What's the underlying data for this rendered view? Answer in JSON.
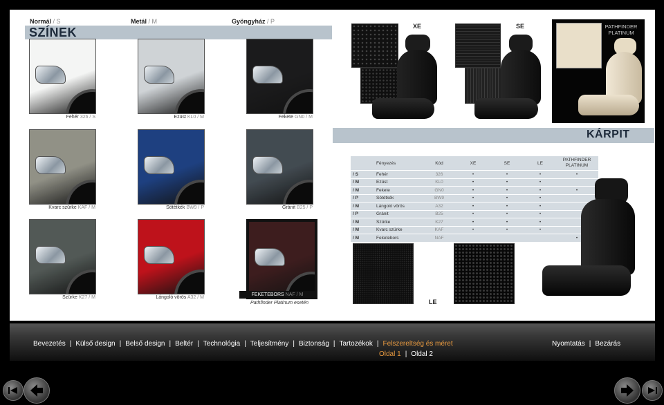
{
  "legend": {
    "normal": {
      "name": "Normál",
      "code": "S"
    },
    "metal": {
      "name": "Metál",
      "code": "M"
    },
    "pearl": {
      "name": "Gyöngyház",
      "code": "P"
    }
  },
  "colors_title": "SZÍNEK",
  "upholstery_title": "KÁRPIT",
  "cars": [
    {
      "name": "Fehér",
      "code": "326 / S",
      "color": "#e8e9e8"
    },
    {
      "name": "Ezüst",
      "code": "KL0 / M",
      "color": "#c5c9cc"
    },
    {
      "name": "Fekete",
      "code": "GN0 / M",
      "color": "#1a1a1b"
    },
    {
      "name": "Kvarc szürke",
      "code": "KAF / M",
      "color": "#8a8a80"
    },
    {
      "name": "Sötétkék",
      "code": "BW9 / P",
      "color": "#1d3d7a"
    },
    {
      "name": "Gránit",
      "code": "B25 / P",
      "color": "#3f474d"
    },
    {
      "name": "Szürke",
      "code": "K27 / M",
      "color": "#4e5552"
    },
    {
      "name": "Lángoló vörös",
      "code": "A32 / M",
      "color": "#b5111a"
    },
    {
      "name": "FEKETEBORS",
      "code": "NAF / M",
      "color": "#3a1c1d",
      "note": "Pathfinder Platinum esetén"
    }
  ],
  "trims": {
    "xe": "XE",
    "se": "SE",
    "platinum": "PATHFINDER PLATINUM",
    "le": "LE"
  },
  "table": {
    "headers": [
      "Fényezés",
      "Kód",
      "XE",
      "SE",
      "LE",
      "PATHFINDER PLATINUM"
    ],
    "rows": [
      {
        "type": "/ S",
        "name": "Fehér",
        "code": "326",
        "xe": "•",
        "se": "•",
        "le": "•",
        "pp": "•"
      },
      {
        "type": "/ M",
        "name": "Ezüst",
        "code": "KL0",
        "xe": "•",
        "se": "•",
        "le": "•",
        "pp": ""
      },
      {
        "type": "/ M",
        "name": "Fekete",
        "code": "GN0",
        "xe": "•",
        "se": "•",
        "le": "•",
        "pp": "•"
      },
      {
        "type": "/ P",
        "name": "Sötétkék",
        "code": "BW9",
        "xe": "•",
        "se": "•",
        "le": "•",
        "pp": ""
      },
      {
        "type": "/ M",
        "name": "Lángoló vörös",
        "code": "A32",
        "xe": "•",
        "se": "•",
        "le": "•",
        "pp": ""
      },
      {
        "type": "/ P",
        "name": "Gránit",
        "code": "B25",
        "xe": "•",
        "se": "•",
        "le": "•",
        "pp": ""
      },
      {
        "type": "/ M",
        "name": "Szürke",
        "code": "K27",
        "xe": "•",
        "se": "•",
        "le": "•",
        "pp": ""
      },
      {
        "type": "/ M",
        "name": "Kvarc szürke",
        "code": "KAF",
        "xe": "•",
        "se": "•",
        "le": "•",
        "pp": ""
      },
      {
        "type": "/ M",
        "name": "Feketebors",
        "code": "NAF",
        "xe": "",
        "se": "",
        "le": "",
        "pp": "•"
      }
    ]
  },
  "nav": {
    "items": [
      "Bevezetés",
      "Külső design",
      "Belső design",
      "Beltér",
      "Technológia",
      "Teljesítmény",
      "Biztonság",
      "Tartozékok",
      "Felszereltség és méret"
    ],
    "right": [
      "Nyomtatás",
      "Bezárás"
    ],
    "pages": [
      "Oldal 1",
      "Oldal 2"
    ],
    "active_color": "#e99a3f"
  }
}
